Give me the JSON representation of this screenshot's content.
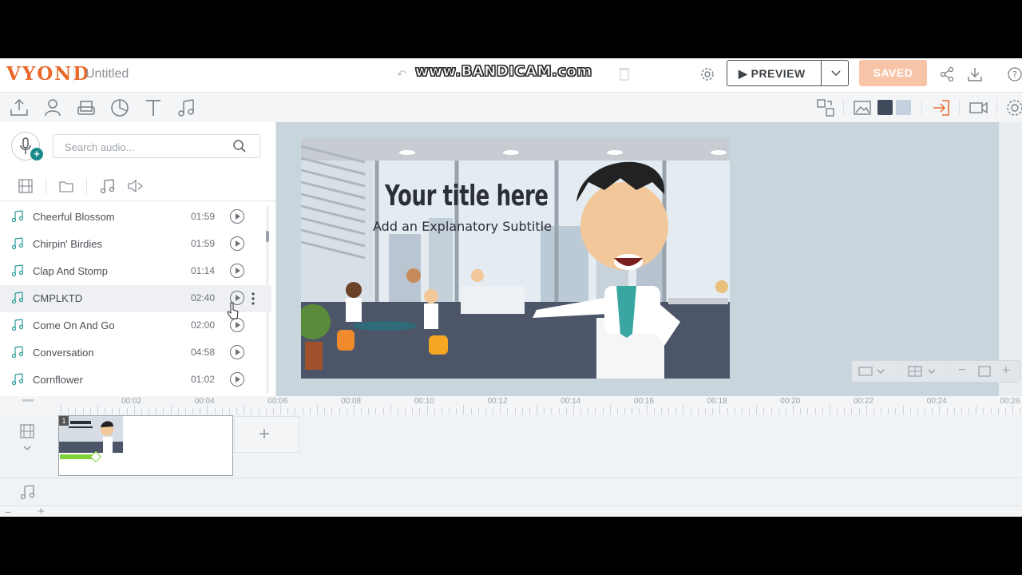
{
  "header": {
    "logo": "VYOND",
    "title": "Untitled",
    "watermark": "www.BANDICAM.com",
    "preview_label": "PREVIEW",
    "saved_label": "SAVED"
  },
  "toolbar": {
    "icons": [
      "upload-icon",
      "character-icon",
      "prop-icon",
      "chart-icon",
      "text-icon",
      "music-icon"
    ],
    "active": "music-icon",
    "swatches": [
      "#3f4b5b",
      "#c5d1e0"
    ]
  },
  "audio_panel": {
    "search_placeholder": "Search audio...",
    "tracks": [
      {
        "name": "Cheerful Blossom",
        "duration": "01:59"
      },
      {
        "name": "Chirpin' Birdies",
        "duration": "01:59"
      },
      {
        "name": "Clap And Stomp",
        "duration": "01:14"
      },
      {
        "name": "CMPLKTD",
        "duration": "02:40"
      },
      {
        "name": "Come On And Go",
        "duration": "02:00"
      },
      {
        "name": "Conversation",
        "duration": "04:58"
      },
      {
        "name": "Cornflower",
        "duration": "01:02"
      }
    ]
  },
  "canvas": {
    "title": "Your title here",
    "subtitle": "Add an Explanatory Subtitle"
  },
  "timeline": {
    "ticks": [
      "00:02",
      "00:04",
      "00:06",
      "00:08",
      "00:10",
      "00:12",
      "00:14",
      "00:16",
      "00:18",
      "00:20",
      "00:22",
      "00:24",
      "00:26"
    ],
    "scene_number": "1"
  },
  "colors": {
    "accent": "#e8692a",
    "saved": "#f8c4a8",
    "teal": "#1a8a8a"
  }
}
